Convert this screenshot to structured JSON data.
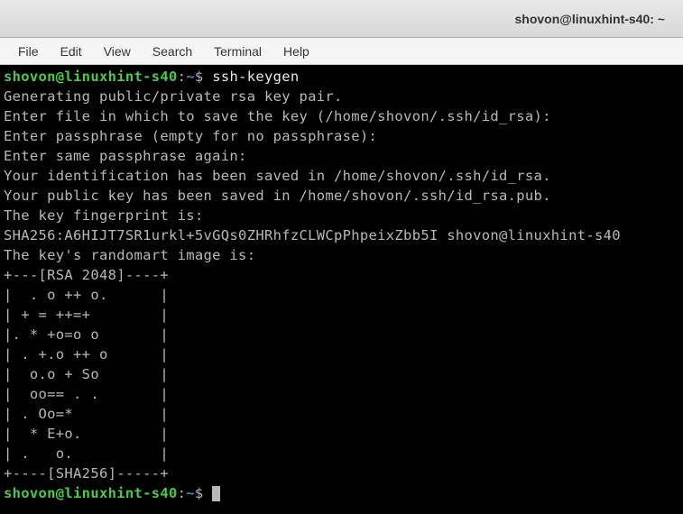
{
  "titlebar": {
    "title": "shovon@linuxhint-s40: ~"
  },
  "menubar": {
    "file": "File",
    "edit": "Edit",
    "view": "View",
    "search": "Search",
    "terminal": "Terminal",
    "help": "Help"
  },
  "terminal": {
    "prompt_user": "shovon@linuxhint-s40",
    "prompt_sep": ":",
    "prompt_path": "~",
    "prompt_dollar": "$",
    "command": "ssh-keygen",
    "lines": {
      "l1": "Generating public/private rsa key pair.",
      "l2": "Enter file in which to save the key (/home/shovon/.ssh/id_rsa):",
      "l3": "Enter passphrase (empty for no passphrase):",
      "l4": "Enter same passphrase again:",
      "l5": "Your identification has been saved in /home/shovon/.ssh/id_rsa.",
      "l6": "Your public key has been saved in /home/shovon/.ssh/id_rsa.pub.",
      "l7": "The key fingerprint is:",
      "l8": "SHA256:A6HIJT7SR1urkl+5vGQs0ZHRhfzCLWCpPhpeixZbb5I shovon@linuxhint-s40",
      "l9": "The key's randomart image is:",
      "l10": "+---[RSA 2048]----+",
      "l11": "|  . o ++ o.      |",
      "l12": "| + = ++=+        |",
      "l13": "|. * +o=o o       |",
      "l14": "| . +.o ++ o      |",
      "l15": "|  o.o + So       |",
      "l16": "|  oo== . .       |",
      "l17": "| . Oo=*          |",
      "l18": "|  * E+o.         |",
      "l19": "| .   o.          |",
      "l20": "+----[SHA256]-----+"
    }
  }
}
